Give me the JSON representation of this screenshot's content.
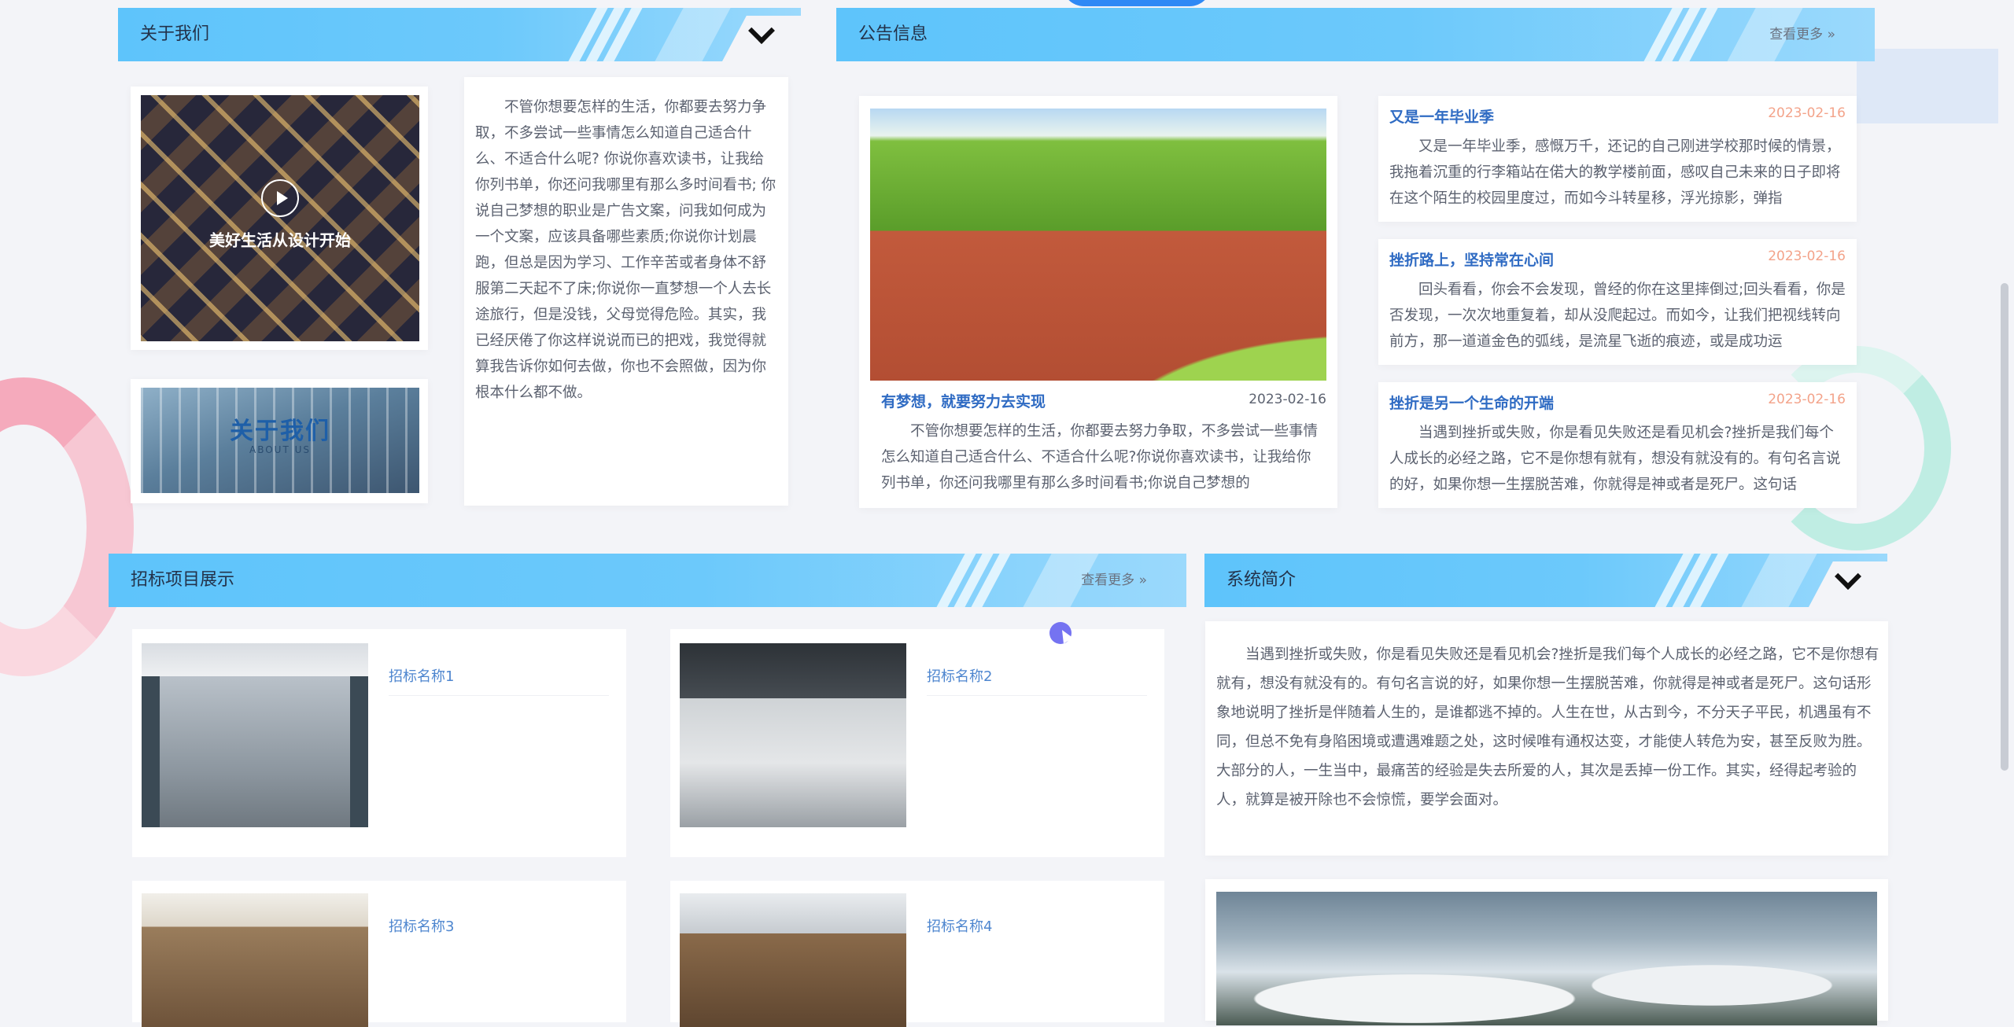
{
  "about": {
    "title": "关于我们",
    "video_caption": "美好生活从设计开始",
    "banner_title": "关于我们",
    "banner_sub": "ABOUT US",
    "text": "不管你想要怎样的生活，你都要去努力争取，不多尝试一些事情怎么知道自己适合什么、不适合什么呢? 你说你喜欢读书，让我给你列书单，你还问我哪里有那么多时间看书; 你说自己梦想的职业是广告文案，问我如何成为一个文案，应该具备哪些素质;你说你计划晨跑，但总是因为学习、工作辛苦或者身体不舒服第二天起不了床;你说你一直梦想一个人去长途旅行，但是没钱，父母觉得危险。其实，我已经厌倦了你这样说说而已的把戏，我觉得就算我告诉你如何去做，你也不会照做，因为你根本什么都不做。"
  },
  "notice": {
    "title": "公告信息",
    "more": "查看更多 »",
    "featured": {
      "title": "有梦想，就要努力去实现",
      "date": "2023-02-16",
      "body": "不管你想要怎样的生活，你都要去努力争取，不多尝试一些事情怎么知道自己适合什么、不适合什么呢?你说你喜欢读书，让我给你列书单，你还问我哪里有那么多时间看书;你说自己梦想的"
    },
    "items": [
      {
        "title": "又是一年毕业季",
        "date": "2023-02-16",
        "body": "又是一年毕业季，感慨万千，还记的自己刚进学校那时候的情景，我拖着沉重的行李箱站在偌大的教学楼前面，感叹自己未来的日子即将在这个陌生的校园里度过，而如今斗转星移，浮光掠影，弹指"
      },
      {
        "title": "挫折路上，坚持常在心间",
        "date": "2023-02-16",
        "body": "回头看看，你会不会发现，曾经的你在这里摔倒过;回头看看，你是否发现，一次次地重复着，却从没爬起过。而如今，让我们把视线转向前方，那一道道金色的弧线，是流星飞逝的痕迹，或是成功运"
      },
      {
        "title": "挫折是另一个生命的开端",
        "date": "2023-02-16",
        "body": "当遇到挫折或失败，你是看见失败还是看见机会?挫折是我们每个人成长的必经之路，它不是你想有就有，想没有就没有的。有句名言说的好，如果你想一生摆脱苦难，你就得是神或者是死尸。这句话"
      }
    ]
  },
  "bids": {
    "title": "招标项目展示",
    "more": "查看更多 »",
    "items": [
      {
        "name": "招标名称1"
      },
      {
        "name": "招标名称2"
      },
      {
        "name": "招标名称3"
      },
      {
        "name": "招标名称4"
      }
    ]
  },
  "system": {
    "title": "系统简介",
    "text": "当遇到挫折或失败，你是看见失败还是看见机会?挫折是我们每个人成长的必经之路，它不是你想有就有，想没有就没有的。有句名言说的好，如果你想一生摆脱苦难，你就得是神或者是死尸。这句话形象地说明了挫折是伴随着人生的，是谁都逃不掉的。人生在世，从古到今，不分天子平民，机遇虽有不同，但总不免有身陷困境或遭遇难题之处，这时候唯有通权达变，才能使人转危为安，甚至反败为胜。大部分的人，一生当中，最痛苦的经验是失去所爱的人，其次是丢掉一份工作。其实，经得起考验的人，就算是被开除也不会惊慌，要学会面对。"
  }
}
